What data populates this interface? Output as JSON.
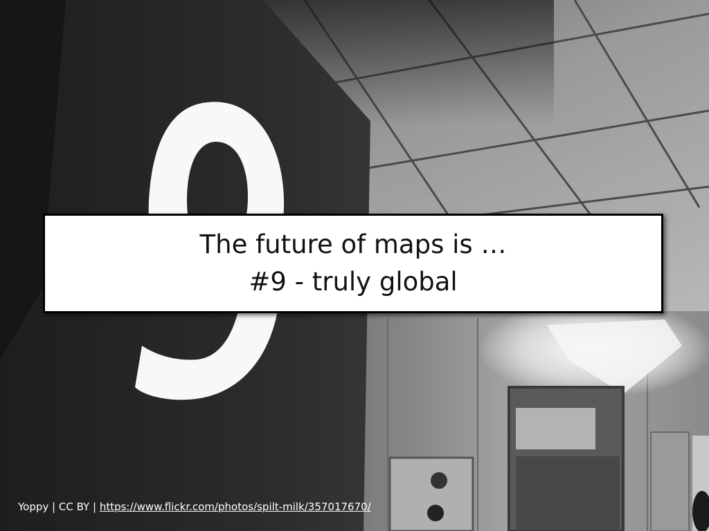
{
  "slide": {
    "title_line1": "The future of maps is …",
    "title_line2": "#9 - truly global"
  },
  "credit": {
    "author": "Yoppy",
    "separator": " | ",
    "license": "CC BY",
    "url": "https://www.flickr.com/photos/spilt-milk/357017670/"
  },
  "photo": {
    "description_icon": "large-illuminated-number-nine-sign",
    "sign_number": "9"
  },
  "colors": {
    "box_background": "#ffffff",
    "box_border": "#000000",
    "text": "#111111",
    "credit_text": "#ffffff"
  }
}
